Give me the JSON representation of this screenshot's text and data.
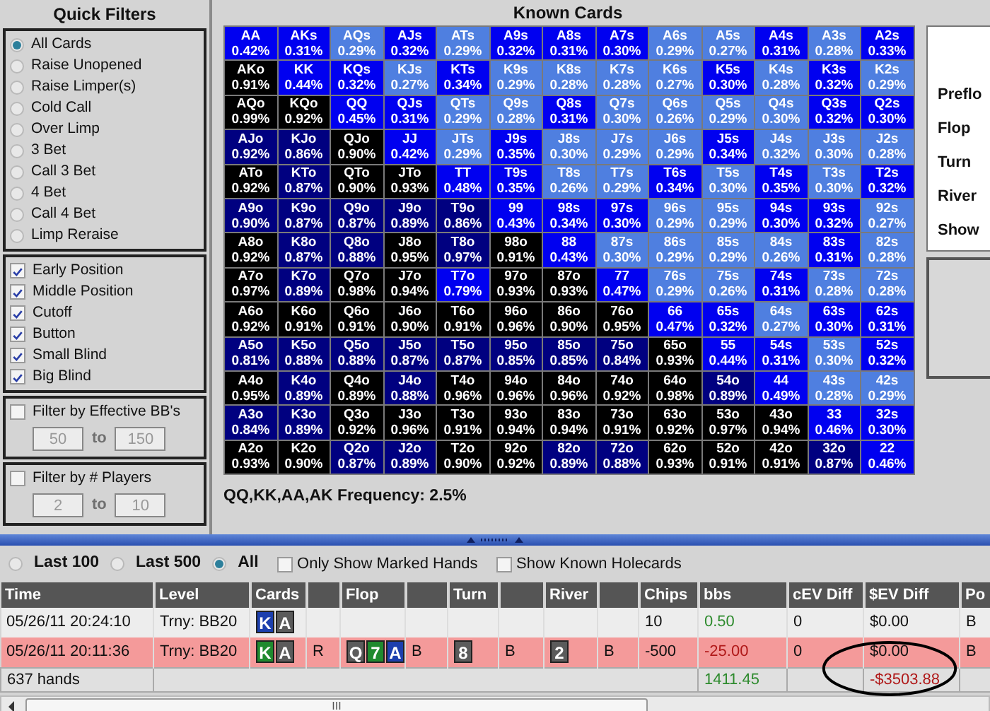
{
  "quick_filters": {
    "title": "Quick Filters",
    "actions": [
      {
        "label": "All Cards",
        "selected": true
      },
      {
        "label": "Raise Unopened",
        "selected": false
      },
      {
        "label": "Raise Limper(s)",
        "selected": false
      },
      {
        "label": "Cold Call",
        "selected": false
      },
      {
        "label": "Over Limp",
        "selected": false
      },
      {
        "label": "3 Bet",
        "selected": false
      },
      {
        "label": "Call 3 Bet",
        "selected": false
      },
      {
        "label": "4 Bet",
        "selected": false
      },
      {
        "label": "Call 4 Bet",
        "selected": false
      },
      {
        "label": "Limp Reraise",
        "selected": false
      }
    ],
    "positions": [
      {
        "label": "Early Position",
        "checked": true
      },
      {
        "label": "Middle Position",
        "checked": true
      },
      {
        "label": "Cutoff",
        "checked": true
      },
      {
        "label": "Button",
        "checked": true
      },
      {
        "label": "Small Blind",
        "checked": true
      },
      {
        "label": "Big Blind",
        "checked": true
      }
    ],
    "range_filters": [
      {
        "label": "Filter by Effective BB's",
        "checked": false,
        "from": "50",
        "joiner": "to",
        "to": "150"
      },
      {
        "label": "Filter by # Players",
        "checked": false,
        "from": "2",
        "joiner": "to",
        "to": "10"
      }
    ]
  },
  "known_cards": {
    "title": "Known Cards",
    "rows": [
      [
        {
          "hand": "AA",
          "pct": "0.42%",
          "color": "#0000f0"
        },
        {
          "hand": "AKs",
          "pct": "0.31%",
          "color": "#0000f0"
        },
        {
          "hand": "AQs",
          "pct": "0.29%",
          "color": "#4f7fe0"
        },
        {
          "hand": "AJs",
          "pct": "0.32%",
          "color": "#0000f0"
        },
        {
          "hand": "ATs",
          "pct": "0.29%",
          "color": "#4f7fe0"
        },
        {
          "hand": "A9s",
          "pct": "0.32%",
          "color": "#0000f0"
        },
        {
          "hand": "A8s",
          "pct": "0.31%",
          "color": "#0000f0"
        },
        {
          "hand": "A7s",
          "pct": "0.30%",
          "color": "#0000f0"
        },
        {
          "hand": "A6s",
          "pct": "0.29%",
          "color": "#4f7fe0"
        },
        {
          "hand": "A5s",
          "pct": "0.27%",
          "color": "#4f7fe0"
        },
        {
          "hand": "A4s",
          "pct": "0.31%",
          "color": "#0000f0"
        },
        {
          "hand": "A3s",
          "pct": "0.28%",
          "color": "#4f7fe0"
        },
        {
          "hand": "A2s",
          "pct": "0.33%",
          "color": "#0000f0"
        }
      ],
      [
        {
          "hand": "AKo",
          "pct": "0.91%",
          "color": "#000000"
        },
        {
          "hand": "KK",
          "pct": "0.44%",
          "color": "#0000f0"
        },
        {
          "hand": "KQs",
          "pct": "0.32%",
          "color": "#0000f0"
        },
        {
          "hand": "KJs",
          "pct": "0.27%",
          "color": "#4f7fe0"
        },
        {
          "hand": "KTs",
          "pct": "0.34%",
          "color": "#0000f0"
        },
        {
          "hand": "K9s",
          "pct": "0.29%",
          "color": "#4f7fe0"
        },
        {
          "hand": "K8s",
          "pct": "0.28%",
          "color": "#4f7fe0"
        },
        {
          "hand": "K7s",
          "pct": "0.28%",
          "color": "#4f7fe0"
        },
        {
          "hand": "K6s",
          "pct": "0.27%",
          "color": "#4f7fe0"
        },
        {
          "hand": "K5s",
          "pct": "0.30%",
          "color": "#0000f0"
        },
        {
          "hand": "K4s",
          "pct": "0.28%",
          "color": "#4f7fe0"
        },
        {
          "hand": "K3s",
          "pct": "0.32%",
          "color": "#0000f0"
        },
        {
          "hand": "K2s",
          "pct": "0.29%",
          "color": "#4f7fe0"
        }
      ],
      [
        {
          "hand": "AQo",
          "pct": "0.99%",
          "color": "#000000"
        },
        {
          "hand": "KQo",
          "pct": "0.92%",
          "color": "#000000"
        },
        {
          "hand": "QQ",
          "pct": "0.45%",
          "color": "#0000f0"
        },
        {
          "hand": "QJs",
          "pct": "0.31%",
          "color": "#0000f0"
        },
        {
          "hand": "QTs",
          "pct": "0.29%",
          "color": "#4f7fe0"
        },
        {
          "hand": "Q9s",
          "pct": "0.28%",
          "color": "#4f7fe0"
        },
        {
          "hand": "Q8s",
          "pct": "0.31%",
          "color": "#0000f0"
        },
        {
          "hand": "Q7s",
          "pct": "0.30%",
          "color": "#4f7fe0"
        },
        {
          "hand": "Q6s",
          "pct": "0.26%",
          "color": "#4f7fe0"
        },
        {
          "hand": "Q5s",
          "pct": "0.29%",
          "color": "#4f7fe0"
        },
        {
          "hand": "Q4s",
          "pct": "0.30%",
          "color": "#4f7fe0"
        },
        {
          "hand": "Q3s",
          "pct": "0.32%",
          "color": "#0000f0"
        },
        {
          "hand": "Q2s",
          "pct": "0.30%",
          "color": "#0000f0"
        }
      ],
      [
        {
          "hand": "AJo",
          "pct": "0.92%",
          "color": "#000080"
        },
        {
          "hand": "KJo",
          "pct": "0.86%",
          "color": "#000080"
        },
        {
          "hand": "QJo",
          "pct": "0.90%",
          "color": "#000000"
        },
        {
          "hand": "JJ",
          "pct": "0.42%",
          "color": "#0000f0"
        },
        {
          "hand": "JTs",
          "pct": "0.29%",
          "color": "#4f7fe0"
        },
        {
          "hand": "J9s",
          "pct": "0.35%",
          "color": "#0000f0"
        },
        {
          "hand": "J8s",
          "pct": "0.30%",
          "color": "#4f7fe0"
        },
        {
          "hand": "J7s",
          "pct": "0.29%",
          "color": "#4f7fe0"
        },
        {
          "hand": "J6s",
          "pct": "0.29%",
          "color": "#4f7fe0"
        },
        {
          "hand": "J5s",
          "pct": "0.34%",
          "color": "#0000f0"
        },
        {
          "hand": "J4s",
          "pct": "0.32%",
          "color": "#4f7fe0"
        },
        {
          "hand": "J3s",
          "pct": "0.30%",
          "color": "#4f7fe0"
        },
        {
          "hand": "J2s",
          "pct": "0.28%",
          "color": "#4f7fe0"
        }
      ],
      [
        {
          "hand": "ATo",
          "pct": "0.92%",
          "color": "#000000"
        },
        {
          "hand": "KTo",
          "pct": "0.87%",
          "color": "#000080"
        },
        {
          "hand": "QTo",
          "pct": "0.90%",
          "color": "#000000"
        },
        {
          "hand": "JTo",
          "pct": "0.93%",
          "color": "#000000"
        },
        {
          "hand": "TT",
          "pct": "0.48%",
          "color": "#0000f0"
        },
        {
          "hand": "T9s",
          "pct": "0.35%",
          "color": "#0000f0"
        },
        {
          "hand": "T8s",
          "pct": "0.26%",
          "color": "#4f7fe0"
        },
        {
          "hand": "T7s",
          "pct": "0.29%",
          "color": "#4f7fe0"
        },
        {
          "hand": "T6s",
          "pct": "0.34%",
          "color": "#0000f0"
        },
        {
          "hand": "T5s",
          "pct": "0.30%",
          "color": "#4f7fe0"
        },
        {
          "hand": "T4s",
          "pct": "0.35%",
          "color": "#0000f0"
        },
        {
          "hand": "T3s",
          "pct": "0.30%",
          "color": "#4f7fe0"
        },
        {
          "hand": "T2s",
          "pct": "0.32%",
          "color": "#0000f0"
        }
      ],
      [
        {
          "hand": "A9o",
          "pct": "0.90%",
          "color": "#000080"
        },
        {
          "hand": "K9o",
          "pct": "0.87%",
          "color": "#000080"
        },
        {
          "hand": "Q9o",
          "pct": "0.87%",
          "color": "#000080"
        },
        {
          "hand": "J9o",
          "pct": "0.89%",
          "color": "#000080"
        },
        {
          "hand": "T9o",
          "pct": "0.86%",
          "color": "#000080"
        },
        {
          "hand": "99",
          "pct": "0.43%",
          "color": "#0000f0"
        },
        {
          "hand": "98s",
          "pct": "0.34%",
          "color": "#0000f0"
        },
        {
          "hand": "97s",
          "pct": "0.30%",
          "color": "#0000f0"
        },
        {
          "hand": "96s",
          "pct": "0.29%",
          "color": "#4f7fe0"
        },
        {
          "hand": "95s",
          "pct": "0.29%",
          "color": "#4f7fe0"
        },
        {
          "hand": "94s",
          "pct": "0.30%",
          "color": "#0000f0"
        },
        {
          "hand": "93s",
          "pct": "0.32%",
          "color": "#0000f0"
        },
        {
          "hand": "92s",
          "pct": "0.27%",
          "color": "#4f7fe0"
        }
      ],
      [
        {
          "hand": "A8o",
          "pct": "0.92%",
          "color": "#000000"
        },
        {
          "hand": "K8o",
          "pct": "0.87%",
          "color": "#000080"
        },
        {
          "hand": "Q8o",
          "pct": "0.88%",
          "color": "#000080"
        },
        {
          "hand": "J8o",
          "pct": "0.95%",
          "color": "#000000"
        },
        {
          "hand": "T8o",
          "pct": "0.97%",
          "color": "#000080"
        },
        {
          "hand": "98o",
          "pct": "0.91%",
          "color": "#000000"
        },
        {
          "hand": "88",
          "pct": "0.43%",
          "color": "#0000f0"
        },
        {
          "hand": "87s",
          "pct": "0.30%",
          "color": "#4f7fe0"
        },
        {
          "hand": "86s",
          "pct": "0.29%",
          "color": "#4f7fe0"
        },
        {
          "hand": "85s",
          "pct": "0.29%",
          "color": "#4f7fe0"
        },
        {
          "hand": "84s",
          "pct": "0.26%",
          "color": "#4f7fe0"
        },
        {
          "hand": "83s",
          "pct": "0.31%",
          "color": "#0000f0"
        },
        {
          "hand": "82s",
          "pct": "0.28%",
          "color": "#4f7fe0"
        }
      ],
      [
        {
          "hand": "A7o",
          "pct": "0.97%",
          "color": "#000000"
        },
        {
          "hand": "K7o",
          "pct": "0.89%",
          "color": "#000080"
        },
        {
          "hand": "Q7o",
          "pct": "0.98%",
          "color": "#000000"
        },
        {
          "hand": "J7o",
          "pct": "0.94%",
          "color": "#000000"
        },
        {
          "hand": "T7o",
          "pct": "0.79%",
          "color": "#0000f0"
        },
        {
          "hand": "97o",
          "pct": "0.93%",
          "color": "#000000"
        },
        {
          "hand": "87o",
          "pct": "0.93%",
          "color": "#000000"
        },
        {
          "hand": "77",
          "pct": "0.47%",
          "color": "#0000f0"
        },
        {
          "hand": "76s",
          "pct": "0.29%",
          "color": "#4f7fe0"
        },
        {
          "hand": "75s",
          "pct": "0.26%",
          "color": "#4f7fe0"
        },
        {
          "hand": "74s",
          "pct": "0.31%",
          "color": "#0000f0"
        },
        {
          "hand": "73s",
          "pct": "0.28%",
          "color": "#4f7fe0"
        },
        {
          "hand": "72s",
          "pct": "0.28%",
          "color": "#4f7fe0"
        }
      ],
      [
        {
          "hand": "A6o",
          "pct": "0.92%",
          "color": "#000000"
        },
        {
          "hand": "K6o",
          "pct": "0.91%",
          "color": "#000000"
        },
        {
          "hand": "Q6o",
          "pct": "0.91%",
          "color": "#000000"
        },
        {
          "hand": "J6o",
          "pct": "0.90%",
          "color": "#000000"
        },
        {
          "hand": "T6o",
          "pct": "0.91%",
          "color": "#000000"
        },
        {
          "hand": "96o",
          "pct": "0.96%",
          "color": "#000000"
        },
        {
          "hand": "86o",
          "pct": "0.90%",
          "color": "#000000"
        },
        {
          "hand": "76o",
          "pct": "0.95%",
          "color": "#000000"
        },
        {
          "hand": "66",
          "pct": "0.47%",
          "color": "#0000f0"
        },
        {
          "hand": "65s",
          "pct": "0.32%",
          "color": "#0000f0"
        },
        {
          "hand": "64s",
          "pct": "0.27%",
          "color": "#4f7fe0"
        },
        {
          "hand": "63s",
          "pct": "0.30%",
          "color": "#0000f0"
        },
        {
          "hand": "62s",
          "pct": "0.31%",
          "color": "#0000f0"
        }
      ],
      [
        {
          "hand": "A5o",
          "pct": "0.81%",
          "color": "#000080"
        },
        {
          "hand": "K5o",
          "pct": "0.88%",
          "color": "#000080"
        },
        {
          "hand": "Q5o",
          "pct": "0.88%",
          "color": "#000080"
        },
        {
          "hand": "J5o",
          "pct": "0.87%",
          "color": "#000080"
        },
        {
          "hand": "T5o",
          "pct": "0.87%",
          "color": "#000080"
        },
        {
          "hand": "95o",
          "pct": "0.85%",
          "color": "#000080"
        },
        {
          "hand": "85o",
          "pct": "0.85%",
          "color": "#000080"
        },
        {
          "hand": "75o",
          "pct": "0.84%",
          "color": "#000080"
        },
        {
          "hand": "65o",
          "pct": "0.93%",
          "color": "#000000"
        },
        {
          "hand": "55",
          "pct": "0.44%",
          "color": "#0000f0"
        },
        {
          "hand": "54s",
          "pct": "0.31%",
          "color": "#0000f0"
        },
        {
          "hand": "53s",
          "pct": "0.30%",
          "color": "#4f7fe0"
        },
        {
          "hand": "52s",
          "pct": "0.32%",
          "color": "#0000f0"
        }
      ],
      [
        {
          "hand": "A4o",
          "pct": "0.95%",
          "color": "#000000"
        },
        {
          "hand": "K4o",
          "pct": "0.89%",
          "color": "#000080"
        },
        {
          "hand": "Q4o",
          "pct": "0.89%",
          "color": "#000000"
        },
        {
          "hand": "J4o",
          "pct": "0.88%",
          "color": "#000080"
        },
        {
          "hand": "T4o",
          "pct": "0.96%",
          "color": "#000000"
        },
        {
          "hand": "94o",
          "pct": "0.96%",
          "color": "#000000"
        },
        {
          "hand": "84o",
          "pct": "0.96%",
          "color": "#000000"
        },
        {
          "hand": "74o",
          "pct": "0.92%",
          "color": "#000000"
        },
        {
          "hand": "64o",
          "pct": "0.98%",
          "color": "#000000"
        },
        {
          "hand": "54o",
          "pct": "0.89%",
          "color": "#000080"
        },
        {
          "hand": "44",
          "pct": "0.49%",
          "color": "#0000f0"
        },
        {
          "hand": "43s",
          "pct": "0.28%",
          "color": "#4f7fe0"
        },
        {
          "hand": "42s",
          "pct": "0.29%",
          "color": "#4f7fe0"
        }
      ],
      [
        {
          "hand": "A3o",
          "pct": "0.84%",
          "color": "#000080"
        },
        {
          "hand": "K3o",
          "pct": "0.89%",
          "color": "#000080"
        },
        {
          "hand": "Q3o",
          "pct": "0.92%",
          "color": "#000000"
        },
        {
          "hand": "J3o",
          "pct": "0.96%",
          "color": "#000000"
        },
        {
          "hand": "T3o",
          "pct": "0.91%",
          "color": "#000000"
        },
        {
          "hand": "93o",
          "pct": "0.94%",
          "color": "#000000"
        },
        {
          "hand": "83o",
          "pct": "0.94%",
          "color": "#000000"
        },
        {
          "hand": "73o",
          "pct": "0.91%",
          "color": "#000000"
        },
        {
          "hand": "63o",
          "pct": "0.92%",
          "color": "#000000"
        },
        {
          "hand": "53o",
          "pct": "0.97%",
          "color": "#000000"
        },
        {
          "hand": "43o",
          "pct": "0.94%",
          "color": "#000000"
        },
        {
          "hand": "33",
          "pct": "0.46%",
          "color": "#0000f0"
        },
        {
          "hand": "32s",
          "pct": "0.30%",
          "color": "#0000f0"
        }
      ],
      [
        {
          "hand": "A2o",
          "pct": "0.93%",
          "color": "#000000"
        },
        {
          "hand": "K2o",
          "pct": "0.90%",
          "color": "#000000"
        },
        {
          "hand": "Q2o",
          "pct": "0.87%",
          "color": "#000080"
        },
        {
          "hand": "J2o",
          "pct": "0.89%",
          "color": "#000080"
        },
        {
          "hand": "T2o",
          "pct": "0.90%",
          "color": "#000000"
        },
        {
          "hand": "92o",
          "pct": "0.92%",
          "color": "#000000"
        },
        {
          "hand": "82o",
          "pct": "0.89%",
          "color": "#000080"
        },
        {
          "hand": "72o",
          "pct": "0.88%",
          "color": "#000080"
        },
        {
          "hand": "62o",
          "pct": "0.93%",
          "color": "#000000"
        },
        {
          "hand": "52o",
          "pct": "0.91%",
          "color": "#000000"
        },
        {
          "hand": "42o",
          "pct": "0.91%",
          "color": "#000000"
        },
        {
          "hand": "32o",
          "pct": "0.87%",
          "color": "#000080"
        },
        {
          "hand": "22",
          "pct": "0.46%",
          "color": "#0000f0"
        }
      ]
    ],
    "frequency": "QQ,KK,AA,AK Frequency: 2.5%"
  },
  "street_panel": {
    "items": [
      "Preflo",
      "Flop",
      "Turn",
      "River",
      "Show"
    ]
  },
  "hand_history": {
    "range_options": [
      {
        "label": "Last 100",
        "selected": false
      },
      {
        "label": "Last 500",
        "selected": false
      },
      {
        "label": "All",
        "selected": true
      }
    ],
    "toggles": [
      {
        "label": "Only Show Marked Hands",
        "checked": false
      },
      {
        "label": "Show Known Holecards",
        "checked": false
      }
    ],
    "columns": [
      {
        "kind": "heading",
        "label": "Time"
      },
      {
        "kind": "heading",
        "label": "Level"
      },
      {
        "kind": "heading",
        "label": "Cards"
      },
      {
        "kind": "blank"
      },
      {
        "kind": "heading",
        "label": "Flop"
      },
      {
        "kind": "blank"
      },
      {
        "kind": "heading",
        "label": "Turn"
      },
      {
        "kind": "blank"
      },
      {
        "kind": "heading",
        "label": "River"
      },
      {
        "kind": "blank"
      },
      {
        "kind": "heading",
        "label": "Chips"
      },
      {
        "kind": "heading",
        "label": "bbs"
      },
      {
        "kind": "heading",
        "label": "cEV Diff"
      },
      {
        "kind": "heading",
        "label": "$EV Diff"
      },
      {
        "kind": "heading",
        "label": "Po"
      }
    ],
    "rows": [
      {
        "selected": false,
        "cells": [
          {
            "kind": "text",
            "text": "05/26/11 20:24:10"
          },
          {
            "kind": "text",
            "text": "Trny: BB20"
          },
          {
            "kind": "cards",
            "cards": [
              {
                "rank": "K",
                "color": "#1c3fae"
              },
              {
                "rank": "A",
                "color": "#5b5b5b"
              }
            ]
          },
          {
            "kind": "empty"
          },
          {
            "kind": "empty"
          },
          {
            "kind": "empty"
          },
          {
            "kind": "empty"
          },
          {
            "kind": "empty"
          },
          {
            "kind": "empty"
          },
          {
            "kind": "empty"
          },
          {
            "kind": "text",
            "text": "10"
          },
          {
            "kind": "text",
            "text": "0.50",
            "color": "#2e8b2e"
          },
          {
            "kind": "text",
            "text": "0"
          },
          {
            "kind": "text",
            "text": "$0.00"
          },
          {
            "kind": "text",
            "text": "B"
          }
        ]
      },
      {
        "selected": true,
        "cells": [
          {
            "kind": "text",
            "text": "05/26/11 20:11:36"
          },
          {
            "kind": "text",
            "text": "Trny: BB20"
          },
          {
            "kind": "cards",
            "cards": [
              {
                "rank": "K",
                "color": "#1f8a2e"
              },
              {
                "rank": "A",
                "color": "#5b5b5b"
              }
            ]
          },
          {
            "kind": "text",
            "text": "R"
          },
          {
            "kind": "cards",
            "cards": [
              {
                "rank": "Q",
                "color": "#5b5b5b"
              },
              {
                "rank": "7",
                "color": "#1f8a2e"
              },
              {
                "rank": "A",
                "color": "#1c3fae"
              }
            ]
          },
          {
            "kind": "text",
            "text": "B"
          },
          {
            "kind": "cards",
            "cards": [
              {
                "rank": "8",
                "color": "#5b5b5b"
              }
            ]
          },
          {
            "kind": "text",
            "text": "B"
          },
          {
            "kind": "cards",
            "cards": [
              {
                "rank": "2",
                "color": "#5b5b5b"
              }
            ]
          },
          {
            "kind": "text",
            "text": "B"
          },
          {
            "kind": "text",
            "text": "-500"
          },
          {
            "kind": "text",
            "text": "-25.00",
            "color": "#b01818"
          },
          {
            "kind": "text",
            "text": "0"
          },
          {
            "kind": "text",
            "text": "$0.00"
          },
          {
            "kind": "text",
            "text": "B"
          }
        ]
      }
    ],
    "summary": {
      "hands": "637 hands",
      "bbs": {
        "text": "1411.45",
        "color": "#2e8b2e"
      },
      "ev": {
        "text": "-$3503.88",
        "color": "#b01818"
      }
    },
    "scrollbar_grip": "III"
  }
}
